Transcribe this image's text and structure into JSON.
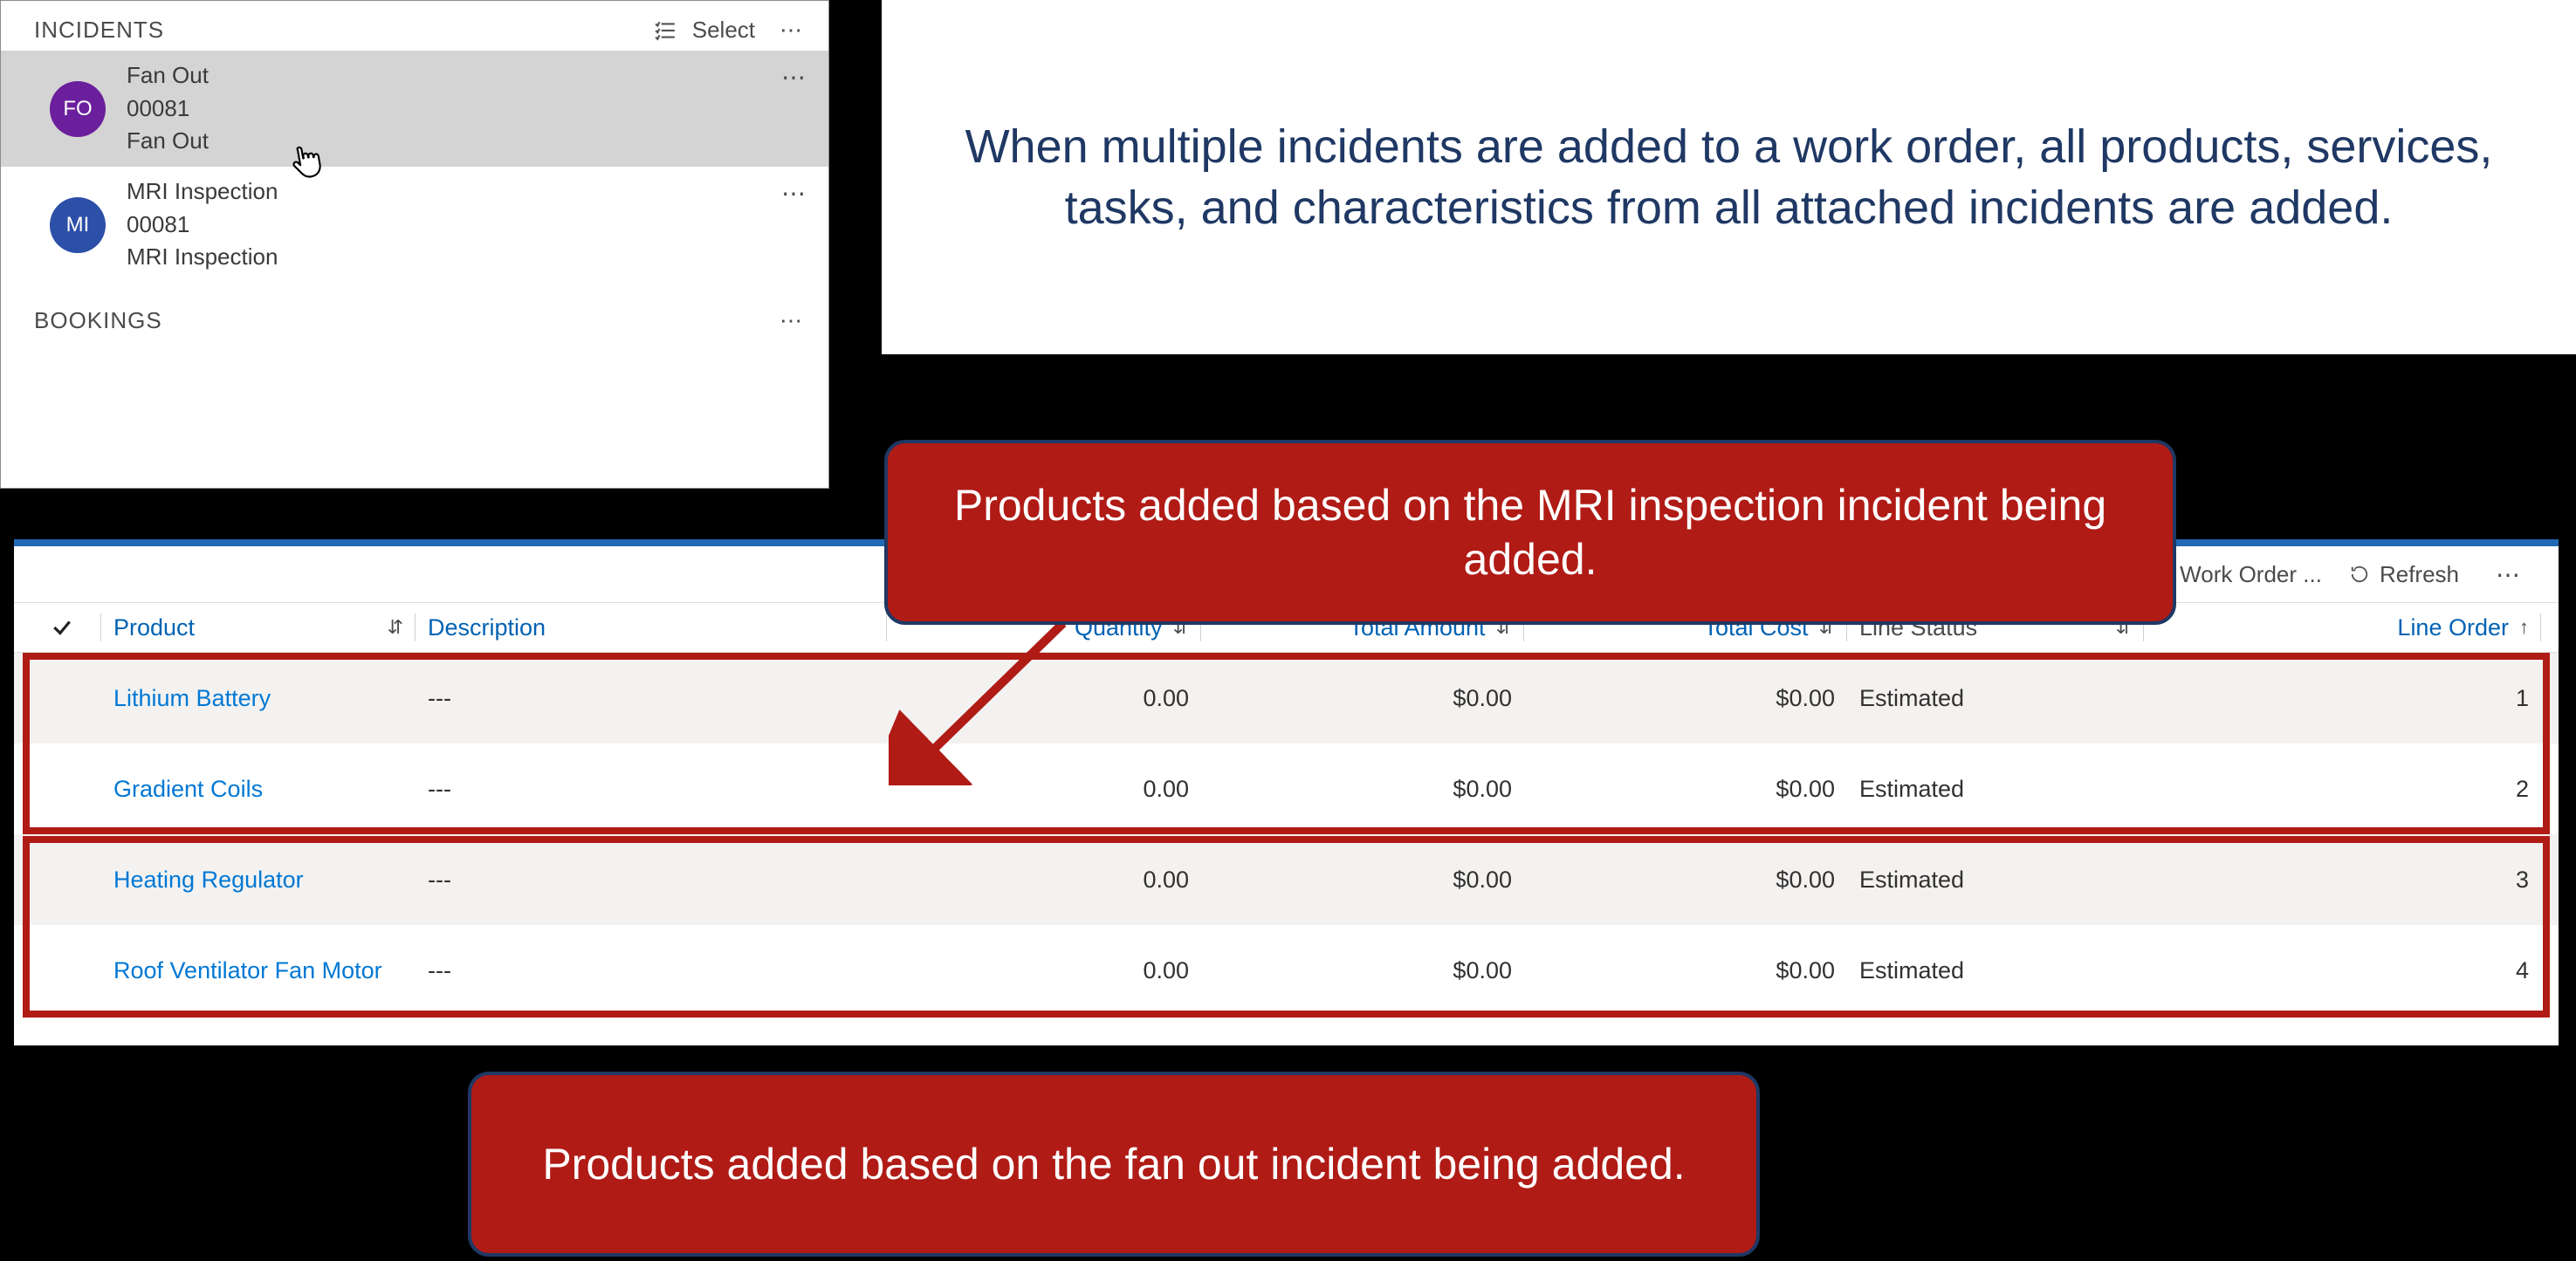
{
  "incidents_panel": {
    "title": "INCIDENTS",
    "select_label": "Select",
    "items": [
      {
        "avatar": "FO",
        "avatar_color": "purple",
        "line1": "Fan Out",
        "line2": "00081",
        "line3": "Fan Out",
        "selected": true
      },
      {
        "avatar": "MI",
        "avatar_color": "blue",
        "line1": "MRI Inspection",
        "line2": "00081",
        "line3": "MRI Inspection",
        "selected": false
      }
    ],
    "bookings_title": "BOOKINGS"
  },
  "explain_text": "When multiple incidents are added to a work order, all products, services, tasks, and characteristics from all attached incidents are added.",
  "callout_top": "Products added based on the MRI inspection incident being added.",
  "callout_bottom": "Products added based on the fan out incident being added.",
  "toolbar": {
    "work_order_label": "Work Order ...",
    "refresh_label": "Refresh"
  },
  "columns": {
    "product": "Product",
    "description": "Description",
    "quantity": "Quantity",
    "total_amount": "Total Amount",
    "total_cost": "Total Cost",
    "line_status": "Line Status",
    "line_order": "Line Order"
  },
  "rows": [
    {
      "product": "Lithium Battery",
      "description": "---",
      "quantity": "0.00",
      "total_amount": "$0.00",
      "total_cost": "$0.00",
      "line_status": "Estimated",
      "line_order": "1"
    },
    {
      "product": "Gradient Coils",
      "description": "---",
      "quantity": "0.00",
      "total_amount": "$0.00",
      "total_cost": "$0.00",
      "line_status": "Estimated",
      "line_order": "2"
    },
    {
      "product": "Heating Regulator",
      "description": "---",
      "quantity": "0.00",
      "total_amount": "$0.00",
      "total_cost": "$0.00",
      "line_status": "Estimated",
      "line_order": "3"
    },
    {
      "product": "Roof Ventilator Fan Motor",
      "description": "---",
      "quantity": "0.00",
      "total_amount": "$0.00",
      "total_cost": "$0.00",
      "line_status": "Estimated",
      "line_order": "4"
    }
  ]
}
